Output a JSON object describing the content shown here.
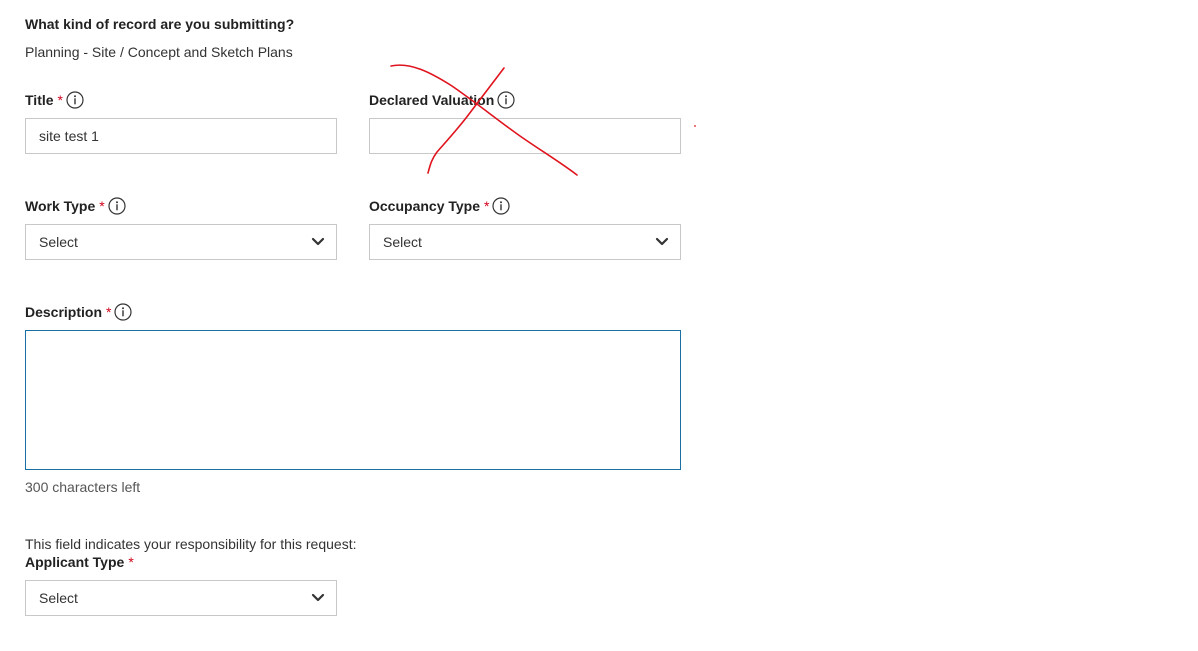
{
  "record_question": {
    "label": "What kind of record are you submitting?",
    "value": "Planning - Site / Concept and Sketch Plans"
  },
  "fields": {
    "title": {
      "label": "Title",
      "required": "*",
      "value": "site test 1"
    },
    "declared_valuation": {
      "label": "Declared Valuation",
      "value": ""
    },
    "work_type": {
      "label": "Work Type",
      "required": "*",
      "selected": "Select"
    },
    "occupancy_type": {
      "label": "Occupancy Type",
      "required": "*",
      "selected": "Select"
    },
    "description": {
      "label": "Description",
      "required": "*",
      "value": "",
      "chars_left_text": "300 characters left"
    },
    "applicant_type": {
      "note": "This field indicates your responsibility for this request:",
      "label": "Applicant Type",
      "required": "*",
      "selected": "Select"
    }
  },
  "icons": {
    "info": "info-circle-icon",
    "dropdown": "chevron-down-icon"
  },
  "colors": {
    "required": "#d0021b",
    "focus_border": "#1a6fa3",
    "annotation": "#e0141e"
  }
}
